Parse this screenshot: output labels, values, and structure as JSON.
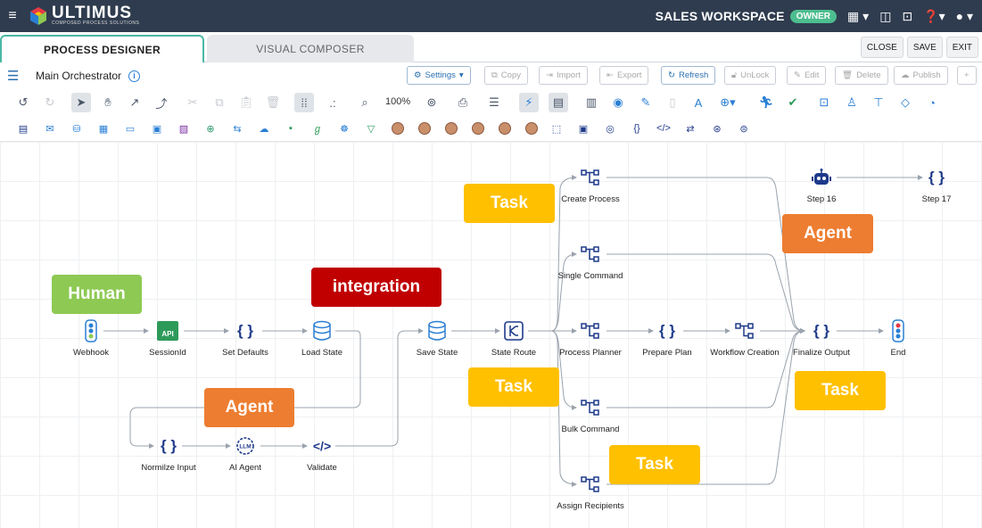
{
  "topbar": {
    "brand": "ULTIMUS",
    "brand_sub": "COMPOSED PROCESS SOLUTIONS",
    "workspace": "SALES WORKSPACE",
    "role_badge": "OWNER"
  },
  "tabs": [
    {
      "label": "PROCESS DESIGNER",
      "active": true
    },
    {
      "label": "VISUAL COMPOSER",
      "active": false
    }
  ],
  "tab_actions": [
    "CLOSE",
    "SAVE",
    "EXIT"
  ],
  "breadcrumb": {
    "title": "Main Orchestrator"
  },
  "actions": [
    "Settings",
    "Copy",
    "Import",
    "Export",
    "Refresh",
    "UnLock",
    "Edit",
    "Delete",
    "Publish",
    "+"
  ],
  "toolbar": {
    "zoom": "100%"
  },
  "nodes": {
    "webhook": "Webhook",
    "sessionid": "SessionId",
    "set_defaults": "Set Defaults",
    "load_state": "Load State",
    "save_state": "Save State",
    "state_route": "State Route",
    "create_process": "Create Process",
    "single_command": "Single Command",
    "process_planner": "Process Planner",
    "bulk_command": "Bulk Command",
    "assign_recipients": "Assign Recipients",
    "prepare_plan": "Prepare Plan",
    "workflow_creation": "Workflow Creation",
    "finalize_output": "Finalize Output",
    "end": "End",
    "step16": "Step 16",
    "step17": "Step 17",
    "normalize_input": "Normilze Input",
    "ai_agent": "AI Agent",
    "validate": "Validate",
    "api_badge": "API",
    "llm_badge": "LLM"
  },
  "callouts": {
    "human": "Human",
    "integration": "integration",
    "agent_top": "Agent",
    "agent_bottom": "Agent",
    "task_1": "Task",
    "task_2": "Task",
    "task_3": "Task",
    "task_4": "Task"
  },
  "colors": {
    "topbar": "#2f3c4f",
    "owner_badge": "#4dbd8f",
    "human": "#8dc953",
    "integration": "#c00000",
    "agent": "#ed7d31",
    "task": "#ffc000",
    "node_icon": "#1e3a8a"
  }
}
